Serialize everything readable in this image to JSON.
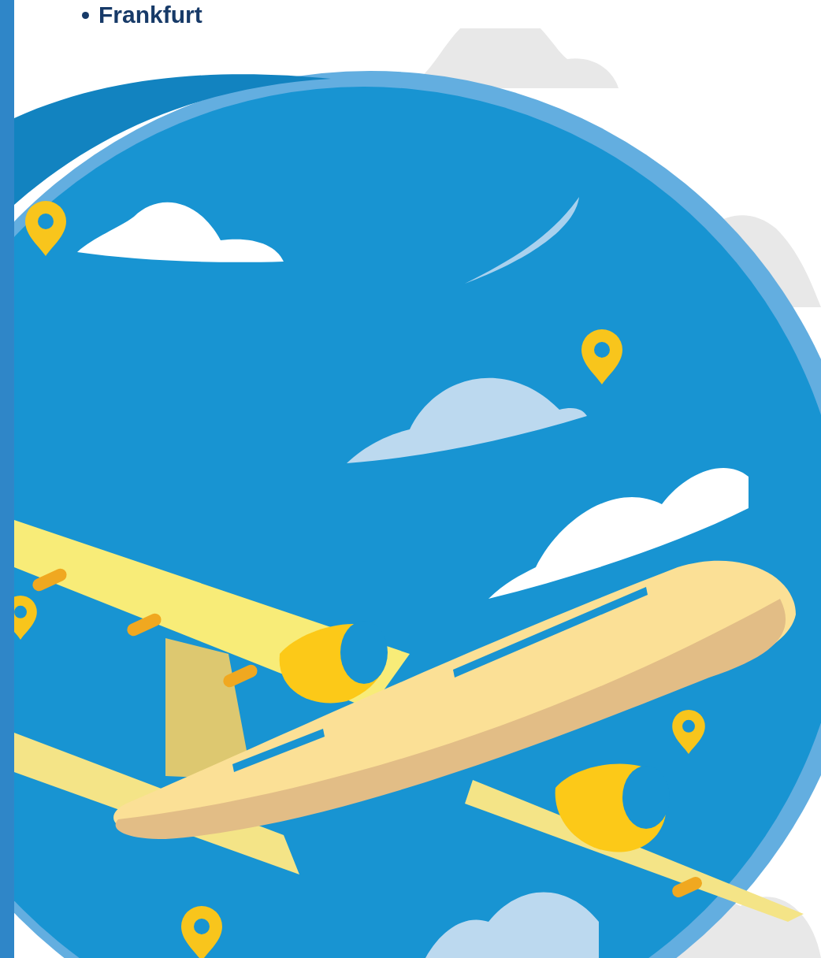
{
  "list_items": [
    {
      "text": "Frankfurt"
    }
  ]
}
